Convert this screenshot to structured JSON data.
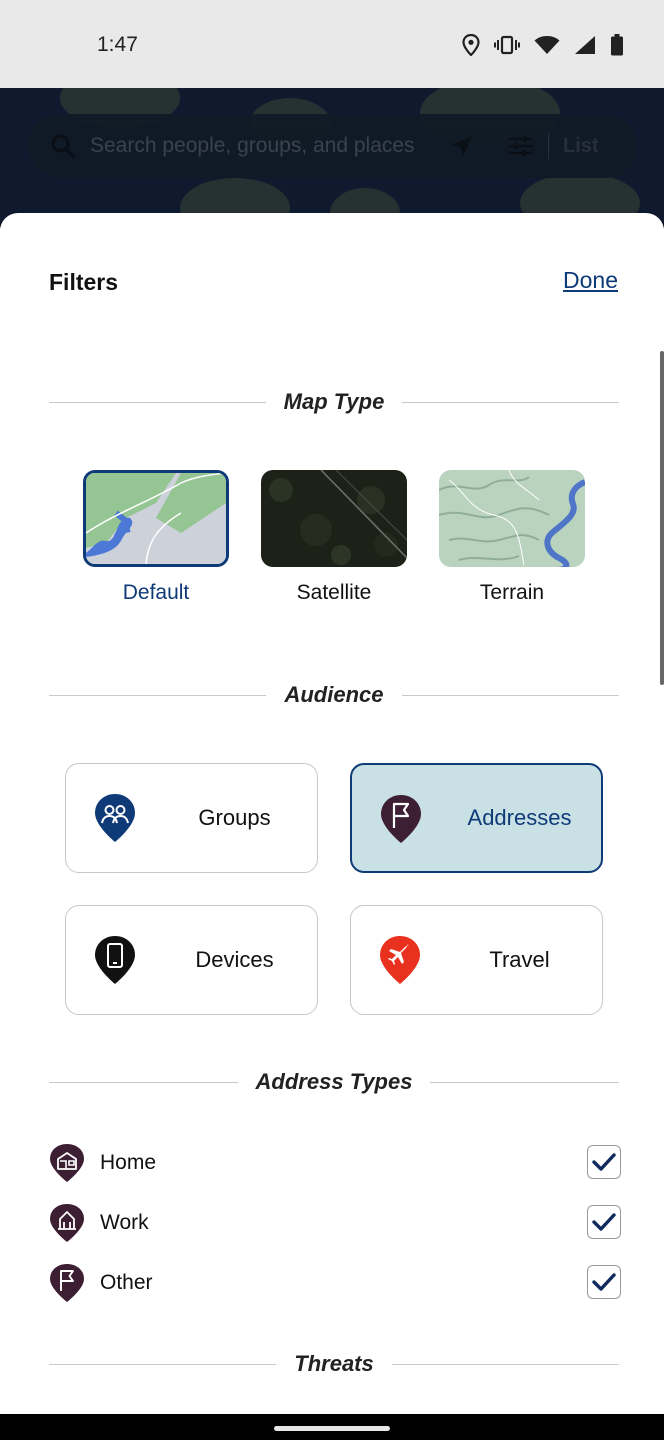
{
  "status_bar": {
    "time": "1:47",
    "icons": [
      "location-icon",
      "vibrate-icon",
      "wifi-icon",
      "signal-icon",
      "battery-icon"
    ]
  },
  "search": {
    "placeholder": "Search people, groups, and places",
    "list_label": "List"
  },
  "sheet": {
    "title": "Filters",
    "done_label": "Done"
  },
  "map_type": {
    "header": "Map Type",
    "options": [
      {
        "label": "Default",
        "selected": true
      },
      {
        "label": "Satellite",
        "selected": false
      },
      {
        "label": "Terrain",
        "selected": false
      }
    ]
  },
  "audience": {
    "header": "Audience",
    "options": [
      {
        "label": "Groups",
        "icon": "groups-icon",
        "selected": false
      },
      {
        "label": "Addresses",
        "icon": "flag-icon",
        "selected": true
      },
      {
        "label": "Devices",
        "icon": "phone-icon",
        "selected": false
      },
      {
        "label": "Travel",
        "icon": "airplane-icon",
        "selected": false
      }
    ]
  },
  "address_types": {
    "header": "Address Types",
    "items": [
      {
        "label": "Home",
        "icon": "home-icon",
        "checked": true
      },
      {
        "label": "Work",
        "icon": "building-icon",
        "checked": true
      },
      {
        "label": "Other",
        "icon": "flag-icon",
        "checked": true
      }
    ]
  },
  "threats": {
    "header": "Threats"
  },
  "colors": {
    "accent": "#0e3a78",
    "selected_bg": "#c9e1e5",
    "address_pin": "#3d1f33",
    "groups_pin": "#0e3a78",
    "devices_pin": "#111111",
    "travel_pin": "#e8321f"
  }
}
